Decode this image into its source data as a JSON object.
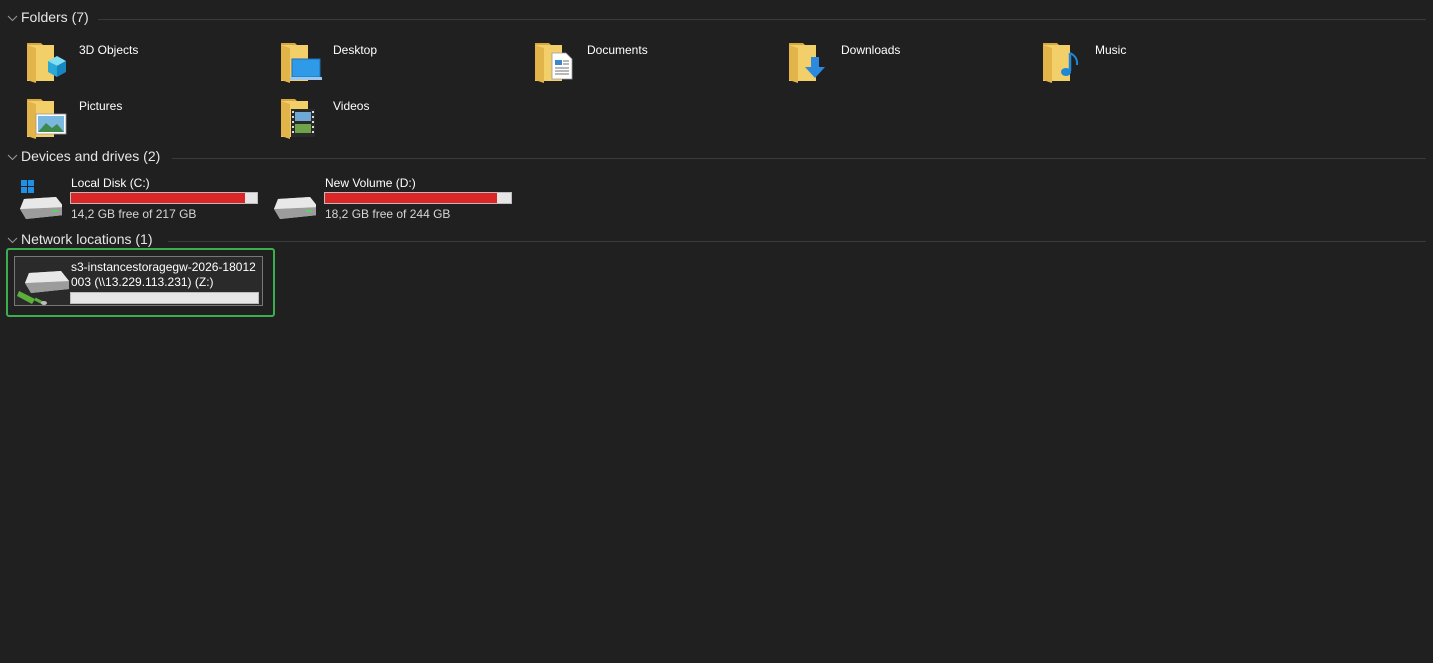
{
  "groups": {
    "folders": {
      "title": "Folders (7)",
      "items": [
        {
          "label": "3D Objects",
          "icon": "folder-3d-objects-icon"
        },
        {
          "label": "Desktop",
          "icon": "folder-desktop-icon"
        },
        {
          "label": "Documents",
          "icon": "folder-documents-icon"
        },
        {
          "label": "Downloads",
          "icon": "folder-downloads-icon"
        },
        {
          "label": "Music",
          "icon": "folder-music-icon"
        },
        {
          "label": "Pictures",
          "icon": "folder-pictures-icon"
        },
        {
          "label": "Videos",
          "icon": "folder-videos-icon"
        }
      ]
    },
    "drives": {
      "title": "Devices and drives (2)",
      "items": [
        {
          "name": "Local Disk (C:)",
          "free_text": "14,2 GB free of 217 GB",
          "used_fraction": 0.935,
          "icon": "system-drive-icon"
        },
        {
          "name": "New Volume (D:)",
          "free_text": "18,2 GB free of 244 GB",
          "used_fraction": 0.925,
          "icon": "hard-drive-icon"
        }
      ]
    },
    "network": {
      "title": "Network locations (1)",
      "items": [
        {
          "name": "s3-instancestoragegw-2026-18012003 (\\\\13.229.113.231) (Z:)",
          "icon": "network-drive-icon",
          "selected": true
        }
      ]
    }
  },
  "colors": {
    "background": "#202020",
    "usage_bar_full": "#da2626",
    "usage_bar_track": "#e6e6e6",
    "selection_outline": "#3dae4e",
    "folder_yellow": "#f3cf6a"
  }
}
